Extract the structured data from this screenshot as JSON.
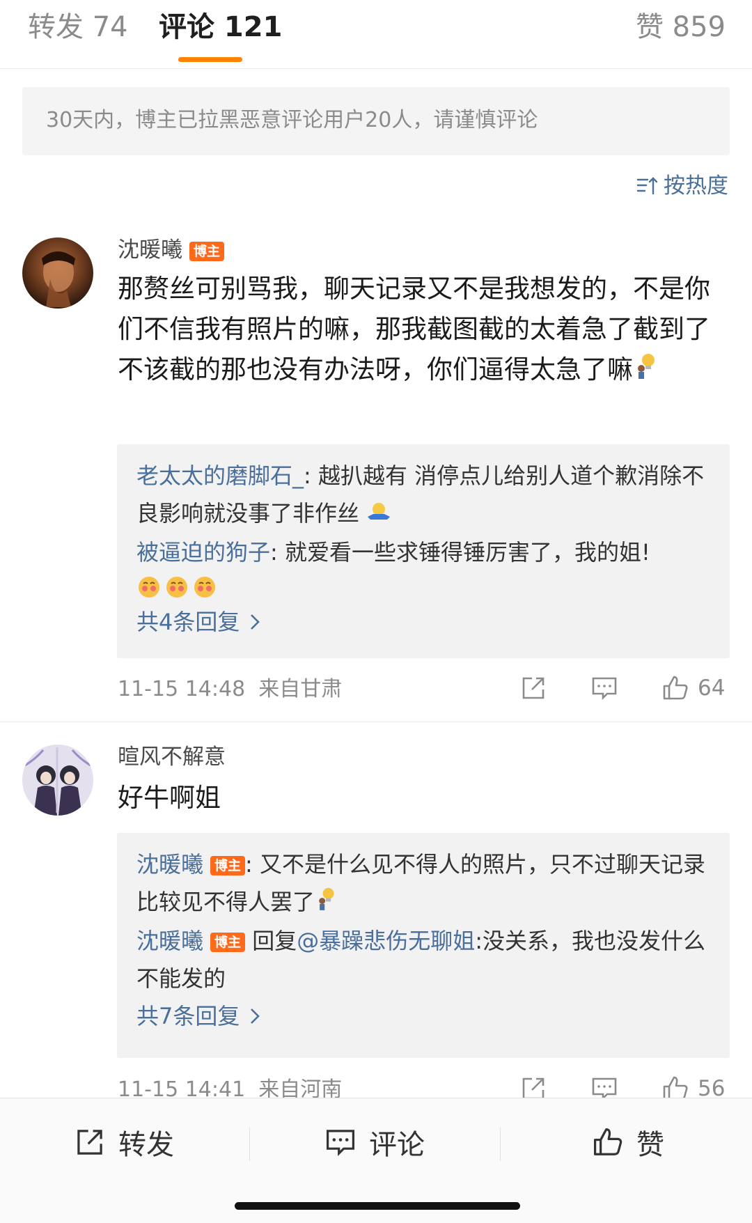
{
  "tabs": {
    "repost": "转发 74",
    "comments": "评论 121",
    "likes": "赞 859"
  },
  "notice": "30天内，博主已拉黑恶意评论用户20人，请谨慎评论",
  "sort_label": "按热度",
  "colors": {
    "accent": "#ff8200",
    "link": "#4a6f9a",
    "badge": "#ff6a1a"
  },
  "comments": [
    {
      "user": "沈暖曦",
      "badge": "博主",
      "text": "那赘丝可别骂我，聊天记录又不是我想发的，不是你们不信我有照片的嘛，那我截图截的太着急了截到了不该截的那也没有办法呀，你们逼得太急了嘛",
      "replies": [
        {
          "user": "老太太的磨脚石_",
          "sep": ": ",
          "text": "越扒越有 消停点儿给别人道个歉消除不良影响就没事了非作丝"
        },
        {
          "user": "被逼迫的狗子",
          "sep": ": ",
          "text": "就爱看一些求锤得锤厉害了，我的姐!"
        }
      ],
      "more": "共4条回复",
      "time": "11-15 14:48",
      "location": "来自甘肃",
      "likes": "64"
    },
    {
      "user": "暄风不解意",
      "text": "好牛啊姐",
      "replies": [
        {
          "user": "沈暖曦",
          "badge": "博主",
          "sep": ": ",
          "text": "又不是什么见不得人的照片，只不过聊天记录比较见不得人罢了"
        },
        {
          "user": "沈暖曦",
          "badge": "博主",
          "prefix": "回复",
          "mention": "@暴躁悲伤无聊姐",
          "text": ":没关系，我也没发什么不能发的"
        }
      ],
      "more": "共7条回复",
      "time": "11-15 14:41",
      "location": "来自河南",
      "likes": "56"
    }
  ],
  "bottom_bar": {
    "repost": "转发",
    "comment": "评论",
    "like": "赞"
  }
}
